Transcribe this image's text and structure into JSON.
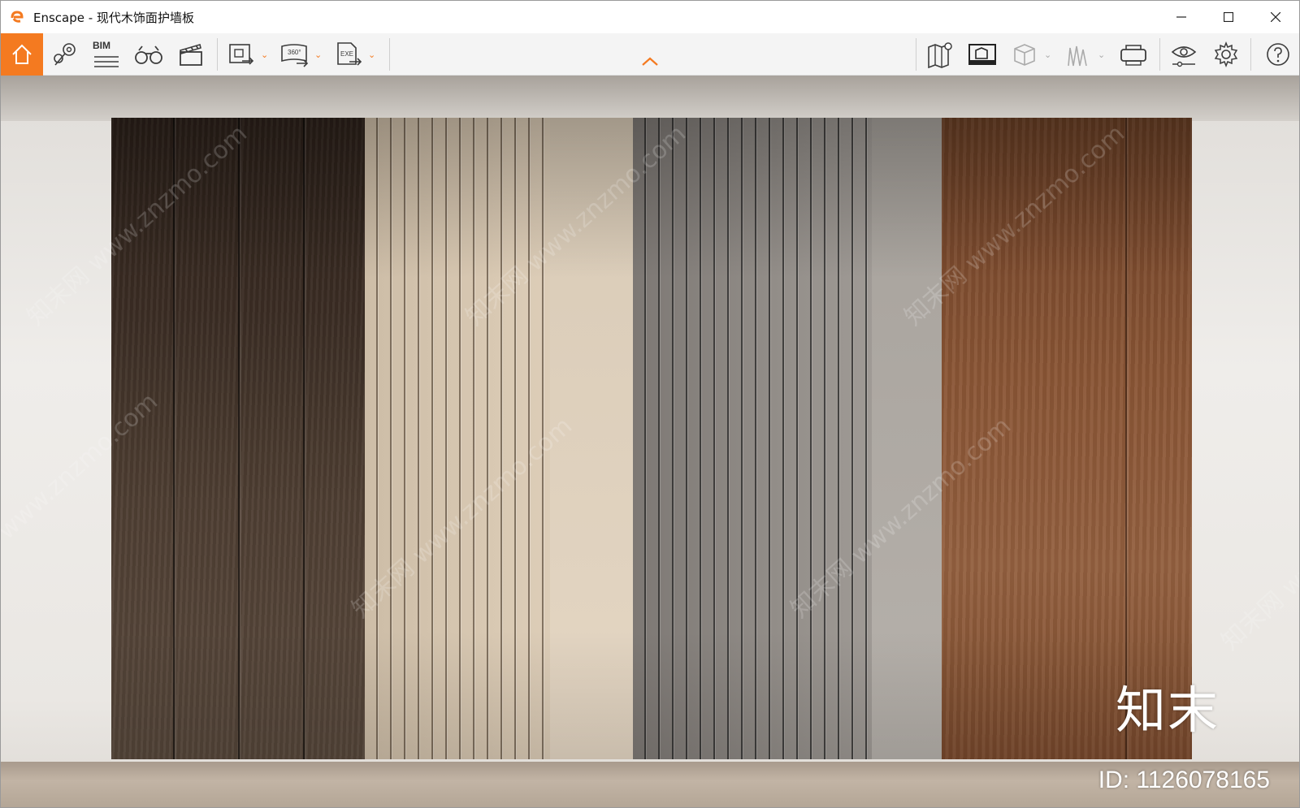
{
  "window": {
    "title": "Enscape - 现代木饰面护墙板",
    "controls": {
      "minimize": "—",
      "maximize": "☐",
      "close": "✕"
    }
  },
  "toolbar": {
    "accent": "#f47a20",
    "left_items": [
      "home-icon",
      "map-pin-icon",
      "bim-icon",
      "binoculars-icon",
      "clapperboard-icon"
    ],
    "bim_label": "BIM",
    "export_items": [
      {
        "icon": "screenshot-export-icon",
        "has_dropdown": true
      },
      {
        "icon": "panorama-export-icon",
        "label": "360°",
        "has_dropdown": true
      },
      {
        "icon": "exe-export-icon",
        "label": "EXE",
        "has_dropdown": true
      }
    ],
    "right_items": [
      "map-icon",
      "asset-library-icon",
      "cube-icon",
      "grass-icon",
      "vr-headset-icon",
      "visual-settings-icon",
      "settings-icon",
      "help-icon"
    ],
    "collapse_icon": "chevron-up-icon"
  },
  "viewport": {
    "watermark_text": "知末网 www.znzmo.com",
    "brand_logo": "知末",
    "image_id": "ID: 1126078165",
    "panels": [
      {
        "name": "dark-walnut",
        "color": "#3b2d24"
      },
      {
        "name": "light-oak-fluted",
        "color": "#d9c9b3"
      },
      {
        "name": "grey-fluted",
        "color": "#948f8a"
      },
      {
        "name": "teak",
        "color": "#8a5535"
      }
    ]
  }
}
